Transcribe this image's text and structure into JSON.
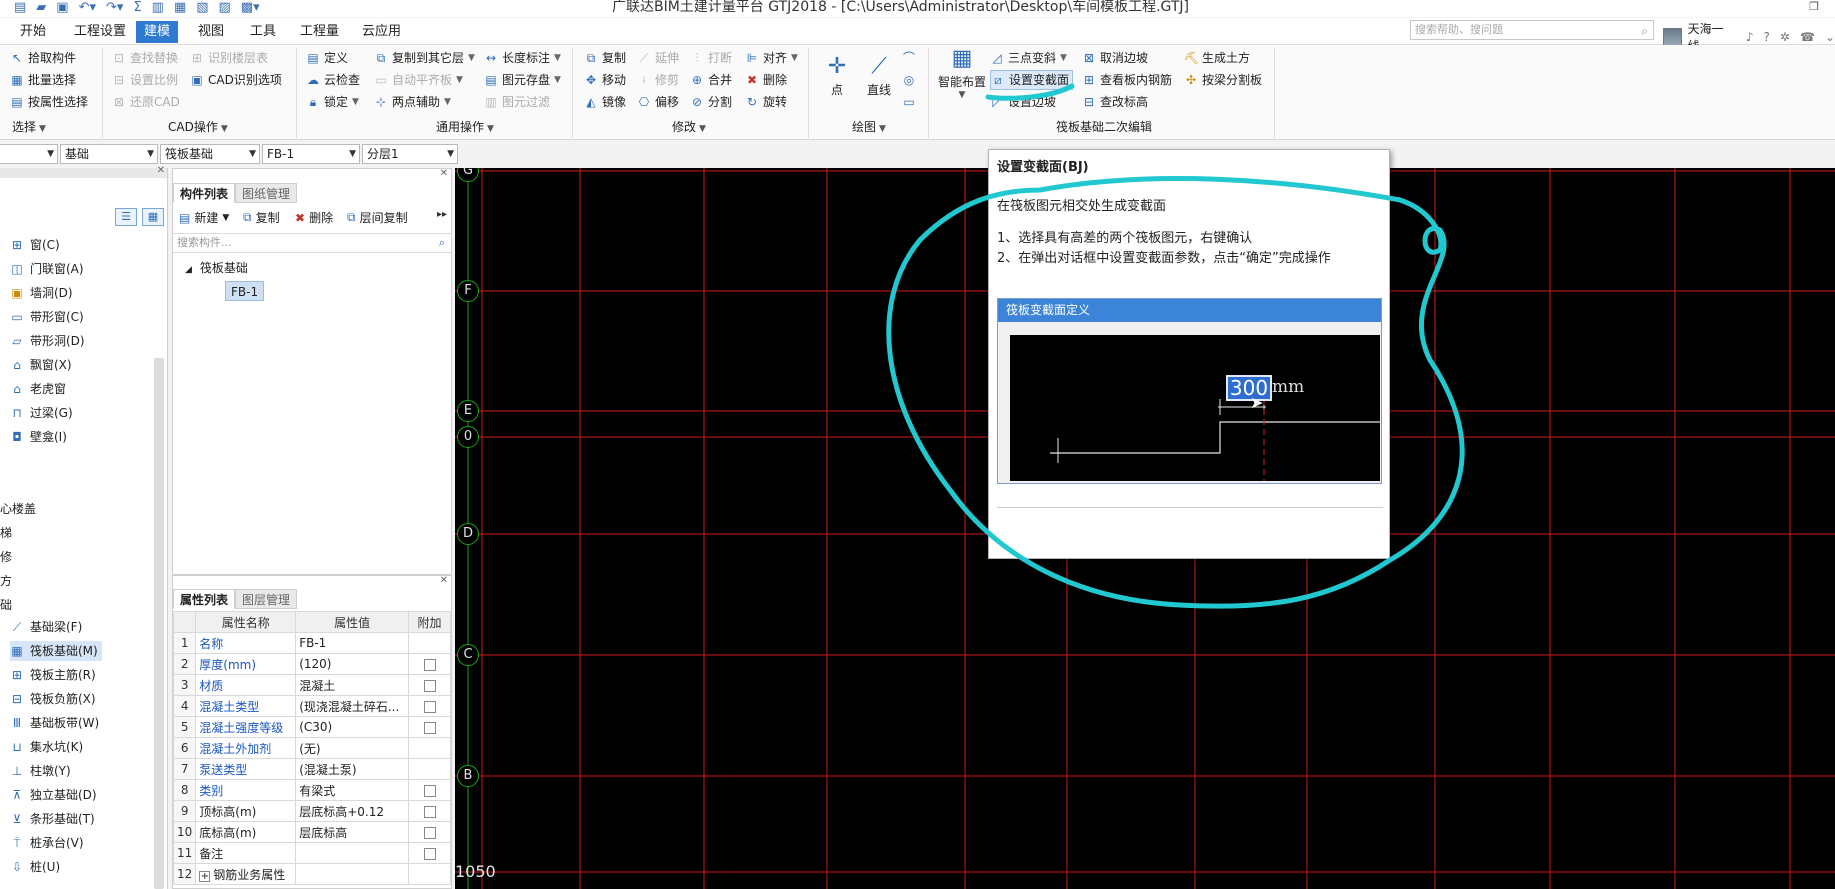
{
  "title": "广联达BIM土建计量平台 GTJ2018 - [C:\\Users\\Administrator\\Desktop\\车间模板工程.GTJ]",
  "menu": {
    "tabs": [
      "开始",
      "工程设置",
      "建模",
      "视图",
      "工具",
      "工程量",
      "云应用"
    ],
    "active": "建模"
  },
  "search": {
    "placeholder": "搜索帮助、搜问题"
  },
  "user": {
    "name": "天海一线"
  },
  "ribbon": {
    "select": {
      "label": "选择",
      "items": [
        "拾取构件",
        "批量选择",
        "按属性选择"
      ]
    },
    "cad": {
      "label": "CAD操作",
      "items": [
        "查找替换",
        "识别楼层表",
        "设置比例",
        "CAD识别选项",
        "还原CAD"
      ]
    },
    "general": {
      "label": "通用操作",
      "items": [
        "定义",
        "复制到其它层",
        "长度标注",
        "云检查",
        "自动平齐板",
        "图元存盘",
        "锁定",
        "两点辅助",
        "图元过滤"
      ]
    },
    "modify": {
      "label": "修改",
      "items": [
        "复制",
        "延伸",
        "打断",
        "对齐",
        "移动",
        "修剪",
        "合并",
        "删除",
        "镜像",
        "偏移",
        "分割",
        "旋转"
      ]
    },
    "draw": {
      "label": "绘图",
      "items": [
        "点",
        "直线"
      ]
    },
    "slab": {
      "label": "筏板基础二次编辑",
      "items": [
        "智能布置",
        "三点变斜",
        "取消边坡",
        "生成土方",
        "设置变截面",
        "查看板内钢筋",
        "按梁分割板",
        "设置边坡",
        "查改标高"
      ]
    }
  },
  "combos": [
    "基础",
    "筏板基础",
    "FB-1",
    "分层1"
  ],
  "nav": {
    "items": [
      "窗(C)",
      "门联窗(A)",
      "墙洞(D)",
      "带形窗(C)",
      "带形洞(D)",
      "飘窗(X)",
      "老虎窗",
      "过梁(G)",
      "壁龛(I)"
    ],
    "sections": [
      "心楼盖",
      "梯",
      "修",
      "方",
      "础"
    ],
    "foundation": [
      "基础梁(F)",
      "筏板基础(M)",
      "筏板主筋(R)",
      "筏板负筋(X)",
      "基础板带(W)",
      "集水坑(K)",
      "柱墩(Y)",
      "独立基础(D)",
      "条形基础(T)",
      "桩承台(V)",
      "桩(U)"
    ],
    "selected": "筏板基础(M)"
  },
  "complist": {
    "tabs": [
      "构件列表",
      "图纸管理"
    ],
    "tools": [
      "新建",
      "复制",
      "删除",
      "层间复制"
    ],
    "search_placeholder": "搜索构件...",
    "tree_root": "筏板基础",
    "tree_item": "FB-1"
  },
  "props": {
    "tabs": [
      "属性列表",
      "图层管理"
    ],
    "headers": [
      "属性名称",
      "属性值",
      "附加"
    ],
    "rows": [
      {
        "n": "1",
        "name": "名称",
        "value": "FB-1",
        "blue": true,
        "check": false
      },
      {
        "n": "2",
        "name": "厚度(mm)",
        "value": "(120)",
        "blue": true,
        "check": true
      },
      {
        "n": "3",
        "name": "材质",
        "value": "混凝土",
        "blue": true,
        "check": true
      },
      {
        "n": "4",
        "name": "混凝土类型",
        "value": "(现浇混凝土碎石...",
        "blue": true,
        "check": true
      },
      {
        "n": "5",
        "name": "混凝土强度等级",
        "value": "(C30)",
        "blue": true,
        "check": true
      },
      {
        "n": "6",
        "name": "混凝土外加剂",
        "value": "(无)",
        "blue": true,
        "check": false
      },
      {
        "n": "7",
        "name": "泵送类型",
        "value": "(混凝土泵)",
        "blue": true,
        "check": false
      },
      {
        "n": "8",
        "name": "类别",
        "value": "有梁式",
        "blue": true,
        "check": true
      },
      {
        "n": "9",
        "name": "顶标高(m)",
        "value": "层底标高+0.12",
        "blue": false,
        "check": true
      },
      {
        "n": "10",
        "name": "底标高(m)",
        "value": "层底标高",
        "blue": false,
        "check": true
      },
      {
        "n": "11",
        "name": "备注",
        "value": "",
        "blue": false,
        "check": true
      },
      {
        "n": "12",
        "name": "钢筋业务属性",
        "value": "",
        "blue": false,
        "check": false
      }
    ]
  },
  "canvas": {
    "axes": [
      "G",
      "F",
      "E",
      "0",
      "D",
      "C",
      "B"
    ],
    "coord": "1050"
  },
  "tooltip": {
    "title": "设置变截面(BJ)",
    "desc": "在筏板图元相交处生成变截面",
    "step1": "1、选择具有高差的两个筏板图元，右键确认",
    "step2": "2、在弹出对话框中设置变截面参数，点击“确定”完成操作",
    "dialog_title": "筏板变截面定义",
    "dim_value": "300",
    "dim_unit": "mm"
  },
  "colors": {
    "accent": "#2e7ad1",
    "grid": "#d01818",
    "annotation": "#22c8d0"
  }
}
